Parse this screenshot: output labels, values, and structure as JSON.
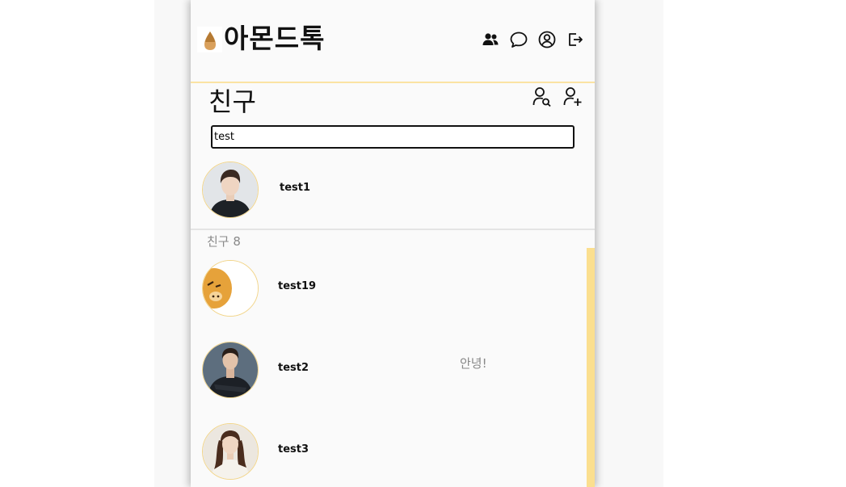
{
  "header": {
    "app_title": "아몬드톡",
    "icons": [
      "friends-icon",
      "chat-icon",
      "profile-icon",
      "logout-icon"
    ]
  },
  "friends": {
    "title": "친구",
    "search_value": "test",
    "icons": [
      "search-friend-icon",
      "add-friend-icon"
    ]
  },
  "search_results": [
    {
      "name": "test1",
      "status": ""
    }
  ],
  "friend_list": {
    "label": "친구 8",
    "items": [
      {
        "name": "test19",
        "status": ""
      },
      {
        "name": "test2",
        "status": "안녕!"
      },
      {
        "name": "test3",
        "status": ""
      }
    ]
  },
  "colors": {
    "accent": "#fbdf8f",
    "header_border": "#fbe3a3",
    "avatar_border": "#f2d58a",
    "background": "#fafafa"
  }
}
